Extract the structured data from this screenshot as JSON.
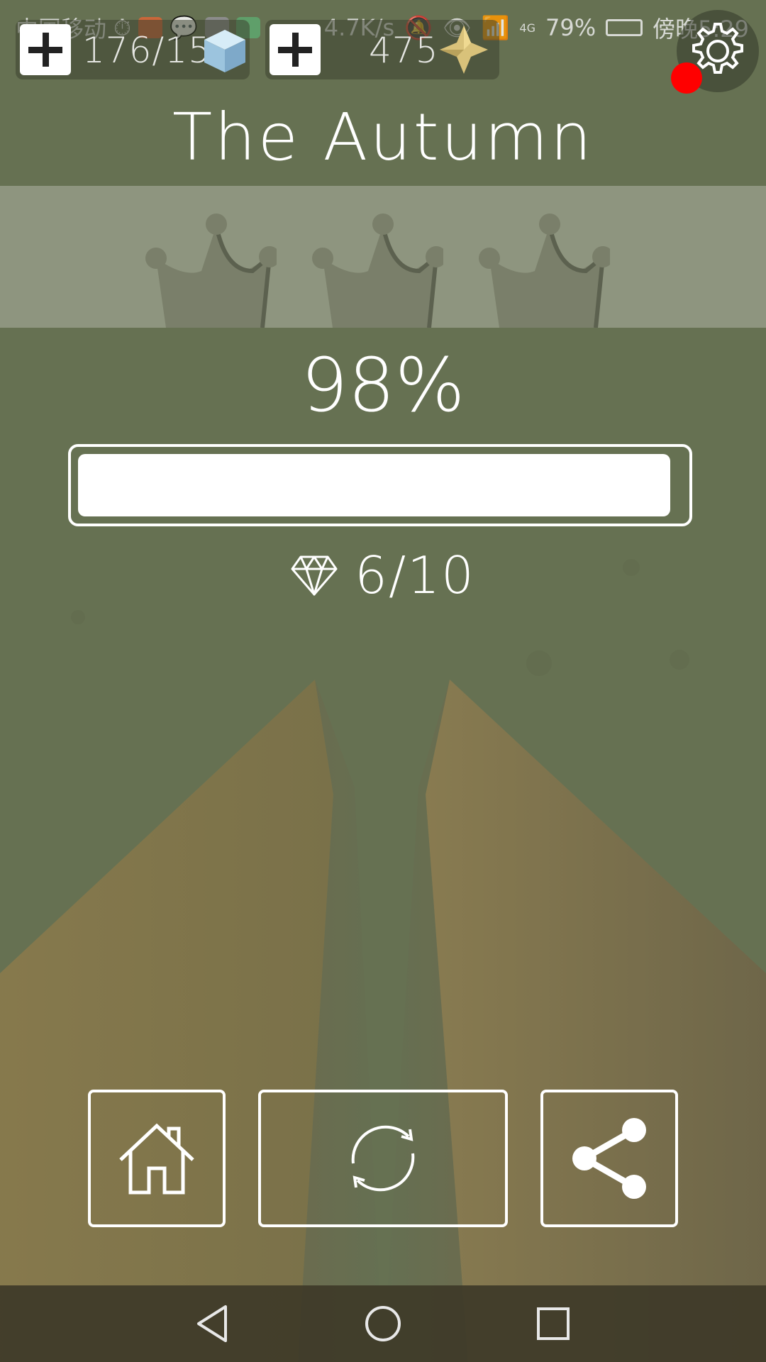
{
  "status_bar": {
    "carrier": "中国移动",
    "speed": "4.7K/s",
    "network": "4G",
    "battery": "79%",
    "time": "傍晚5:29"
  },
  "resources": {
    "cubes": {
      "value": "176/15",
      "icon": "ice-cube-icon"
    },
    "stars": {
      "value": "475",
      "icon": "gold-star-icon"
    }
  },
  "level": {
    "title": "The Autumn",
    "crowns_earned": 0,
    "crowns_total": 3,
    "percent_text": "98%",
    "progress": 0.98,
    "gems_text": "6/10"
  },
  "actions": {
    "home_icon": "home-icon",
    "retry_icon": "refresh-icon",
    "share_icon": "share-icon"
  },
  "nav": {
    "back_icon": "triangle-back-icon",
    "home_icon": "circle-home-icon",
    "recents_icon": "square-recents-icon"
  },
  "colors": {
    "background": "#667152",
    "band": "#8e957f",
    "crown": "#7a7f6a",
    "path": "#a18a55",
    "alert": "#ff0000"
  }
}
